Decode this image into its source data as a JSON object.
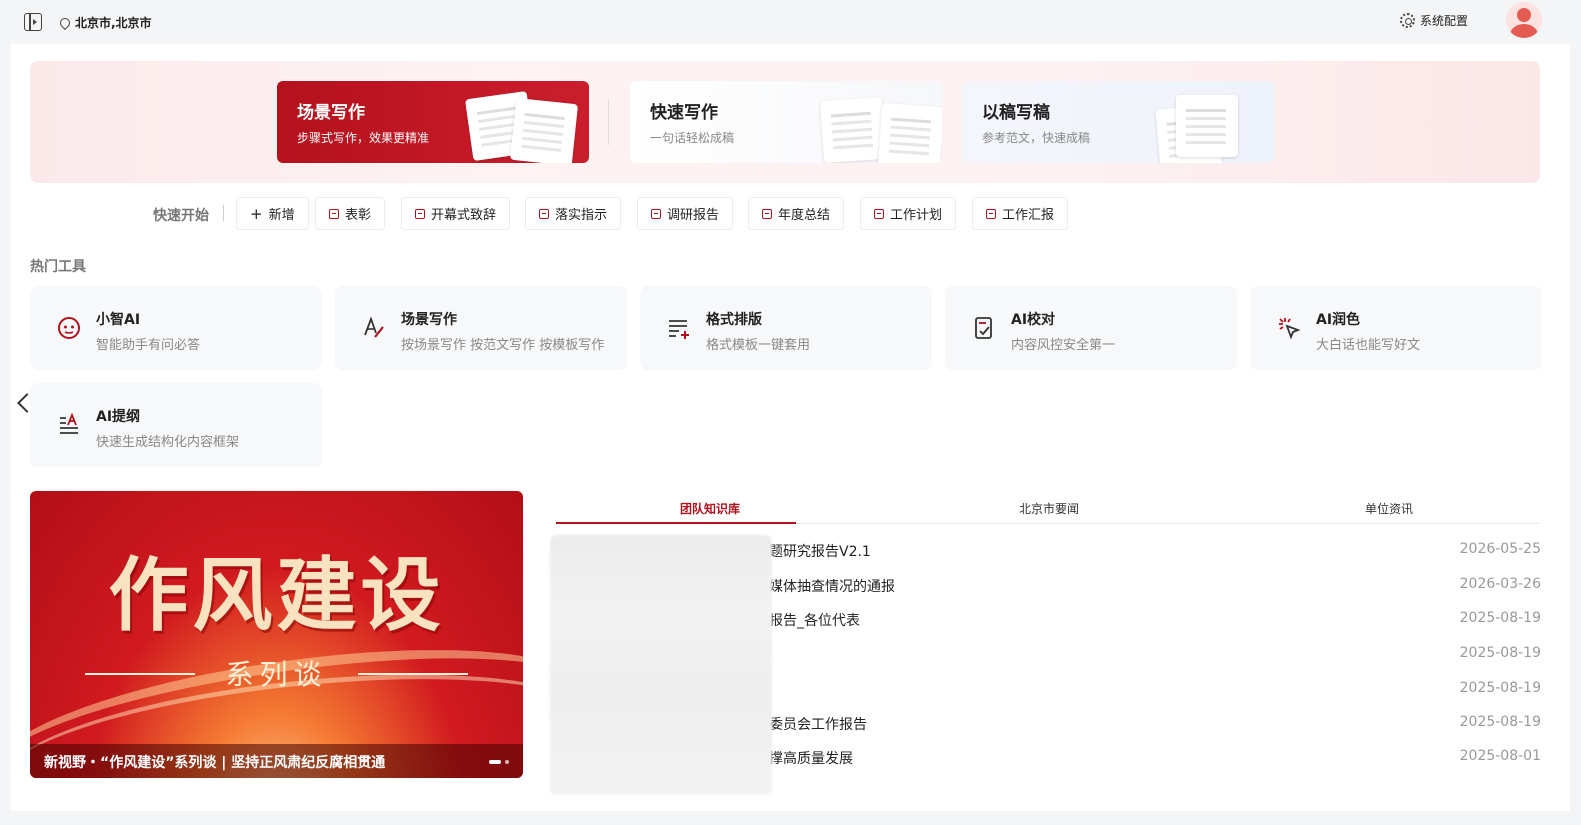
{
  "topbar": {
    "location": "北京市,北京市",
    "settings_label": "系统配置"
  },
  "hero": {
    "modes": [
      {
        "title": "场景写作",
        "subtitle": "步骤式写作，效果更精准"
      },
      {
        "title": "快速写作",
        "subtitle": "一句话轻松成稿"
      },
      {
        "title": "以稿写稿",
        "subtitle": "参考范文，快速成稿"
      }
    ]
  },
  "quick_start": {
    "label": "快速开始",
    "buttons": [
      "新增",
      "表彰",
      "开幕式致辞",
      "落实指示",
      "调研报告",
      "年度总结",
      "工作计划",
      "工作汇报"
    ]
  },
  "hot_tools": {
    "title": "热门工具",
    "items": [
      {
        "name": "小智AI",
        "desc": "智能助手有问必答",
        "icon": "robot-icon"
      },
      {
        "name": "场景写作",
        "desc": "按场景写作 按范文写作 按模板写作",
        "icon": "pen-writing-icon"
      },
      {
        "name": "格式排版",
        "desc": "格式模板一键套用",
        "icon": "format-list-icon"
      },
      {
        "name": "AI校对",
        "desc": "内容风控安全第一",
        "icon": "proofread-icon"
      },
      {
        "name": "AI润色",
        "desc": "大白话也能写好文",
        "icon": "magic-cursor-icon"
      },
      {
        "name": "AI提纲",
        "desc": "快速生成结构化内容框架",
        "icon": "outline-icon"
      }
    ]
  },
  "banner": {
    "headline": "作风建设",
    "subline": "系列谈",
    "caption": "新视野・“作风建设”系列谈 | 坚持正风肃纪反腐相贯通"
  },
  "news": {
    "tabs": [
      "团队知识库",
      "北京市要闻",
      "单位资讯"
    ],
    "active_tab": 0,
    "rows": [
      {
        "title": "题研究报告V2.1",
        "date": "2026-05-25"
      },
      {
        "title": "媒体抽查情况的通报",
        "date": "2026-03-26"
      },
      {
        "title": "报告_各位代表",
        "date": "2025-08-19"
      },
      {
        "title": "",
        "date": "2025-08-19"
      },
      {
        "title": "",
        "date": "2025-08-19"
      },
      {
        "title": "委员会工作报告",
        "date": "2025-08-19"
      },
      {
        "title": "撑高质量发展",
        "date": "2025-08-01"
      }
    ]
  },
  "colors": {
    "accent": "#b3121d",
    "hero_bg": "#fbe9ea",
    "card_bg": "#f7f8fa"
  }
}
